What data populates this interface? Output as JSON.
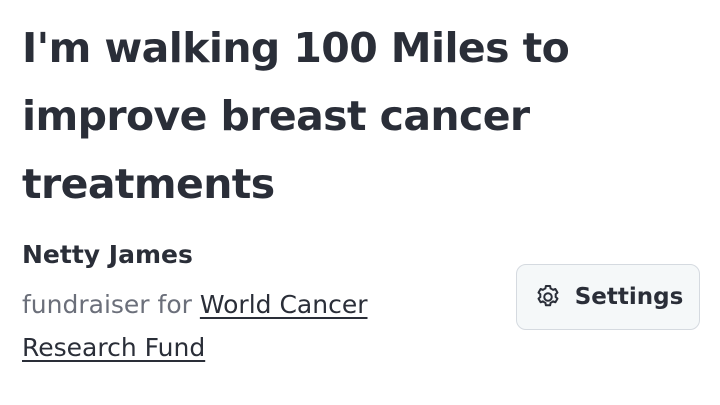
{
  "campaign": {
    "title": "I'm walking 100 Miles to improve breast cancer treatments"
  },
  "fundraiser": {
    "name": "Netty James",
    "role_text": "fundraiser for",
    "charity_name": "World Cancer Research Fund"
  },
  "actions": {
    "settings_label": "Settings",
    "settings_icon": "gear-icon"
  }
}
